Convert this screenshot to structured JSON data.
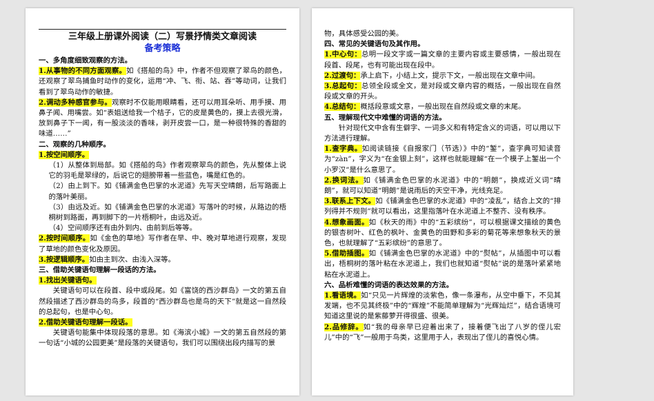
{
  "left_page": {
    "title": "三年级上册课外阅读（二）写景抒情类文章阅读",
    "subtitle": "备考策略",
    "blocks": [
      {
        "type": "heading",
        "text": "一、多角度细致观察的方法。"
      },
      {
        "type": "para",
        "hl": "1.从事物的不同方面观察。",
        "text": "如《搭船的鸟》中，作者不但观察了翠鸟的颜色，还观察了翠鸟捕鱼时动作的变化，运用“冲、飞、衔、站、吞”等动词，让我们看到了翠鸟动作的敏捷。"
      },
      {
        "type": "para",
        "hl": "2.调动多种感官参与。",
        "text": "观察时不仅能用眼睛看，还可以用耳朵听、用手摸、用鼻子闻、用嘴尝。如“表姐送给我一个桔子，它的皮是黄色的，摸上去很光滑，放到鼻子下一闻，有一股淡淡的香味，剥开皮尝一口，是一种很特殊的香甜的味道……”"
      },
      {
        "type": "heading",
        "text": "二、观察的几种顺序。"
      },
      {
        "type": "para",
        "hl": "1.按空间顺序。",
        "text": ""
      },
      {
        "type": "sub",
        "text": "（1）从整体到局部。如《搭船的鸟》作者观察翠鸟的颜色，先从整体上说它的羽毛是翠绿的，后说它的翅膀带着一些蓝色，嘴是红色的。"
      },
      {
        "type": "sub",
        "text": "（2）由上到下。如《铺满金色巴掌的水泥道》先写天空晴朗，后写路面上的落叶美丽。"
      },
      {
        "type": "sub",
        "text": "（3）由远及近。如《铺满金色巴掌的水泥道》写落叶的时候，从路边的梧桐树到路面，再到脚下的一片梧桐叶，由远及近。"
      },
      {
        "type": "sub",
        "text": "（4）空间顺序还有由外到内、由前到后等等。"
      },
      {
        "type": "para",
        "hl": "2.按时间顺序。",
        "text": "如《金色的草地》写作者在早、中、晚对草地进行观察，发现了草地的颜色变化及原因。"
      },
      {
        "type": "para",
        "hl": "3.按逻辑顺序。",
        "text": "如由主到次、由浅入深等。"
      },
      {
        "type": "heading",
        "text": "三、借助关键语句理解一段话的方法。"
      },
      {
        "type": "para",
        "hl": "1.找出关键语句。",
        "text": ""
      },
      {
        "type": "indent",
        "text": "关键语句可以在段首、段中或段尾。如《富饶的西沙群岛》一文的第五自然段描述了西沙群岛的鸟多，段首的“西沙群岛也是鸟的天下”就是这一自然段的总起句，也是中心句。"
      },
      {
        "type": "para",
        "hl": "2.借助关键语句理解一段话。",
        "text": ""
      },
      {
        "type": "indent",
        "text": "关键语句能集中体现段落的意思。如《海滨小城》一文的第五自然段的第一句话“小城的公园更美”是段落的关键语句，我们可以围绕出段内描写的景"
      }
    ]
  },
  "right_page": {
    "blocks": [
      {
        "type": "plain",
        "text": "物，具体感受公园的美。"
      },
      {
        "type": "heading",
        "text": "四、常见的关键语句及其作用。"
      },
      {
        "type": "para",
        "hl": "1.中心句：",
        "text": "总明一段文字或一篇文章的主要内容或主要感情，一般出现在段首、段尾，也有可能出现在段中。"
      },
      {
        "type": "para",
        "hl": "2.过渡句：",
        "text": "承上启下，小结上文，提示下文，一般出现在文章中间。"
      },
      {
        "type": "para",
        "hl": "3.总起句：",
        "text": "总领全段或全文，是对段或文章内容的概括，一般出现在自然段或文章的开头。"
      },
      {
        "type": "para",
        "hl": "4.总结句：",
        "text": "概括段意或文意，一般出现在自然段或文章的末尾。"
      },
      {
        "type": "heading",
        "text": "五、理解现代文中难懂的词语的方法。"
      },
      {
        "type": "indent",
        "text": "针对现代文中含有生僻字、一词多义和有特定含义的词语，可以用以下方法进行理解。"
      },
      {
        "type": "para",
        "hl": "1.查字典。",
        "text": "如阅读链接《自报家门（节选）》中的“錾”，查字典可知读音为“zàn”，字义为“在金银上刻”，这样也就能理解“在一个模子上錾出一个小罗汉”是什么意思了。"
      },
      {
        "type": "para",
        "hl": "2.换词法。",
        "text": "如《铺满金色巴掌的水泥道》中的“明朗”，换成近义词“晴朗”，就可以知道“明朗”是说雨后的天空干净，光线充足。"
      },
      {
        "type": "para",
        "hl": "3.联系上下文。",
        "text": "如《铺满金色巴掌的水泥道》中的“凌乱”，结合上文的“排列得并不规则”就可以看出，这里指落叶在水泥道上不整齐、没有秩序。"
      },
      {
        "type": "para",
        "hl": "4.想象画面。",
        "text": "如《秋天的雨》中的“五彩缤纷”，可以根据课文描绘的黄色的银杏树叶、红色的枫叶、金黄色的田野和多彩的菊花等来想象秋天的景色，也就理解了“五彩缤纷”的意思了。"
      },
      {
        "type": "para",
        "hl": "5.借助插图。",
        "text": "如《铺满金色巴掌的水泥道》中的“熨帖”，从插图中可以看出，梧桐树的落叶粘在水泥道上，我们也就知道“熨帖”说的是落叶紧紧地粘在水泥道上。"
      },
      {
        "type": "heading",
        "text": "六、品析难懂的词语的表达效果的方法。"
      },
      {
        "type": "para",
        "hl": "1.看语境。",
        "text": "如“只见一片辉煌的淡紫色，像一条瀑布，从空中垂下，不见其发端，也不见其终极”中的“辉煌”不能简单理解为“光辉灿烂”，结合语境可知道这里说的是紫藤萝开得很盛、很美。"
      },
      {
        "type": "para",
        "hl": "2.品修辞。",
        "text": "如“我的母亲早已迎着出来了，接着便飞出了八岁的侄儿宏儿”中的“飞”一般用于鸟类，这里用于人，表现出了侄儿的喜悦心情。"
      }
    ]
  }
}
